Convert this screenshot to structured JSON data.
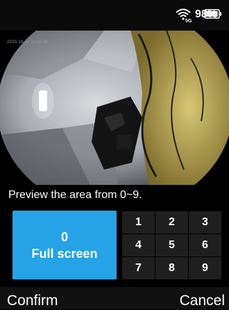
{
  "status_bar": {
    "network": "5G",
    "battery_percent": "98%",
    "battery_level": 0.98,
    "wifi_icon": "wifi-5g-icon",
    "battery_icon": "battery-icon"
  },
  "preview": {
    "timestamp": "2020-10-10 12:00:00"
  },
  "instruction": "Preview the area from 0~9.",
  "full_screen": {
    "number": "0",
    "label": "Full screen",
    "color": "#25a3e6"
  },
  "keypad": {
    "keys": [
      "1",
      "2",
      "3",
      "4",
      "5",
      "6",
      "7",
      "8",
      "9"
    ]
  },
  "softkeys": {
    "confirm": "Confirm",
    "cancel": "Cancel"
  }
}
